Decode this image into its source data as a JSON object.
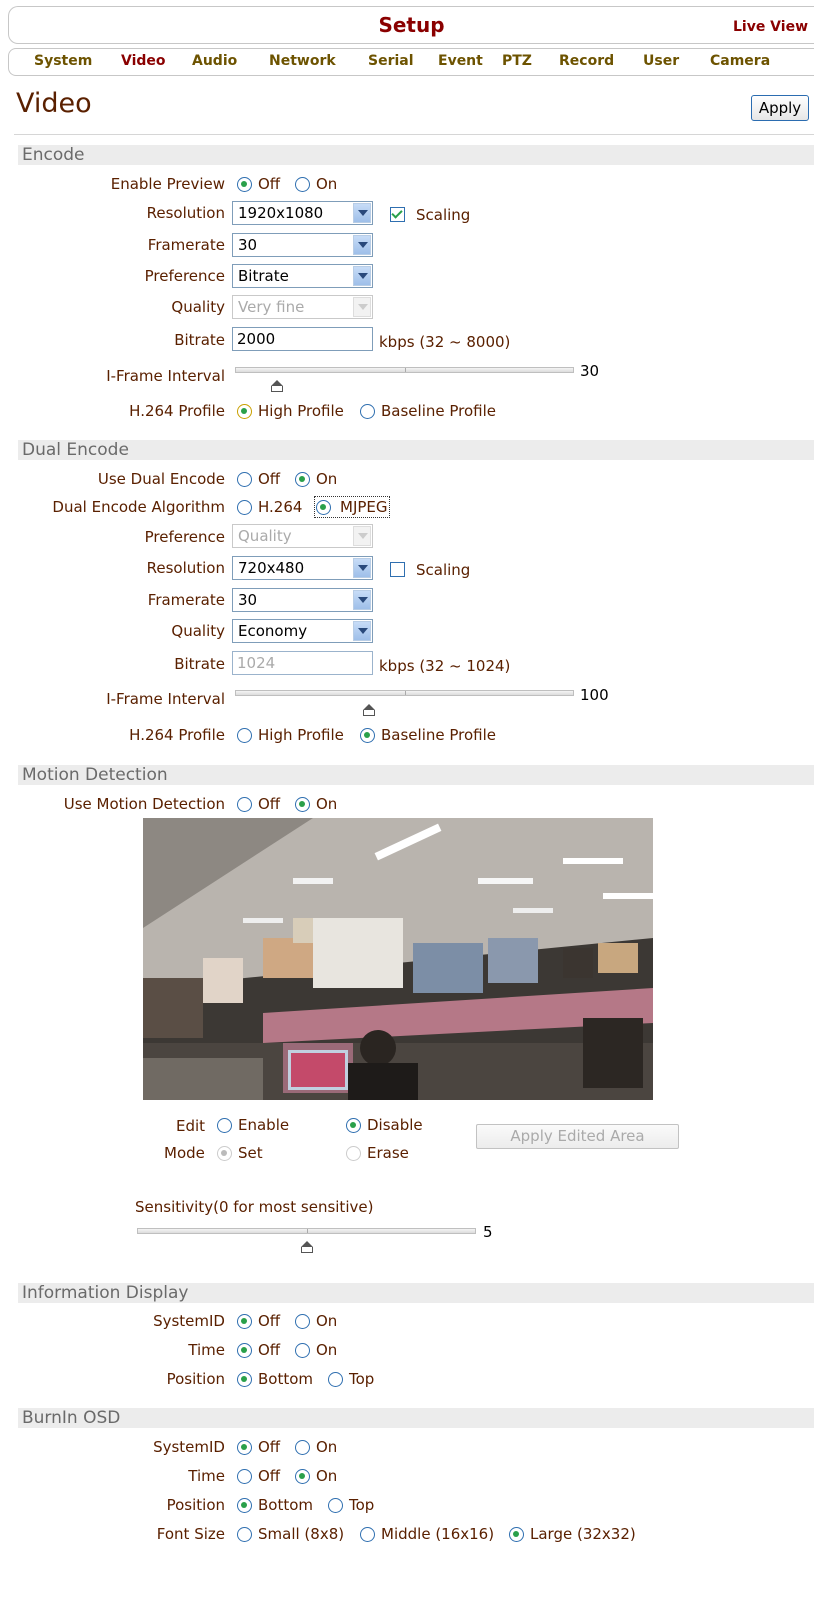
{
  "header": {
    "title": "Setup",
    "live_view": "Live View"
  },
  "nav": [
    "System",
    "Video",
    "Audio",
    "Network",
    "Serial",
    "Event",
    "PTZ",
    "Record",
    "User",
    "Camera"
  ],
  "page": {
    "title": "Video",
    "apply": "Apply"
  },
  "encode": {
    "section": "Encode",
    "enable_preview": {
      "label": "Enable Preview",
      "off": "Off",
      "on": "On"
    },
    "resolution": {
      "label": "Resolution",
      "value": "1920x1080",
      "scaling": "Scaling"
    },
    "framerate": {
      "label": "Framerate",
      "value": "30"
    },
    "preference": {
      "label": "Preference",
      "value": "Bitrate"
    },
    "quality": {
      "label": "Quality",
      "value": "Very fine"
    },
    "bitrate": {
      "label": "Bitrate",
      "value": "2000",
      "unit": "kbps (32 ~ 8000)"
    },
    "iframe": {
      "label": "I-Frame Interval",
      "value": "30"
    },
    "profile": {
      "label": "H.264 Profile",
      "high": "High Profile",
      "baseline": "Baseline Profile"
    }
  },
  "dual": {
    "section": "Dual Encode",
    "use": {
      "label": "Use Dual Encode",
      "off": "Off",
      "on": "On"
    },
    "algorithm": {
      "label": "Dual Encode Algorithm",
      "h264": "H.264",
      "mjpeg": "MJPEG"
    },
    "preference": {
      "label": "Preference",
      "value": "Quality"
    },
    "resolution": {
      "label": "Resolution",
      "value": "720x480",
      "scaling": "Scaling"
    },
    "framerate": {
      "label": "Framerate",
      "value": "30"
    },
    "quality": {
      "label": "Quality",
      "value": "Economy"
    },
    "bitrate": {
      "label": "Bitrate",
      "value": "1024",
      "unit": "kbps (32 ~ 1024)"
    },
    "iframe": {
      "label": "I-Frame Interval",
      "value": "100"
    },
    "profile": {
      "label": "H.264 Profile",
      "high": "High Profile",
      "baseline": "Baseline Profile"
    }
  },
  "motion": {
    "section": "Motion Detection",
    "use": {
      "label": "Use Motion Detection",
      "off": "Off",
      "on": "On"
    },
    "edit": {
      "label": "Edit",
      "enable": "Enable",
      "disable": "Disable"
    },
    "mode": {
      "label": "Mode",
      "set": "Set",
      "erase": "Erase"
    },
    "apply_area": "Apply Edited Area",
    "sensitivity": {
      "label": "Sensitivity(0 for most sensitive)",
      "value": "5"
    }
  },
  "info": {
    "section": "Information Display",
    "systemid": {
      "label": "SystemID",
      "off": "Off",
      "on": "On"
    },
    "time": {
      "label": "Time",
      "off": "Off",
      "on": "On"
    },
    "position": {
      "label": "Position",
      "bottom": "Bottom",
      "top": "Top"
    }
  },
  "osd": {
    "section": "BurnIn OSD",
    "systemid": {
      "label": "SystemID",
      "off": "Off",
      "on": "On"
    },
    "time": {
      "label": "Time",
      "off": "Off",
      "on": "On"
    },
    "position": {
      "label": "Position",
      "bottom": "Bottom",
      "top": "Top"
    },
    "fontsize": {
      "label": "Font Size",
      "small": "Small (8x8)",
      "middle": "Middle (16x16)",
      "large": "Large (32x32)"
    }
  }
}
